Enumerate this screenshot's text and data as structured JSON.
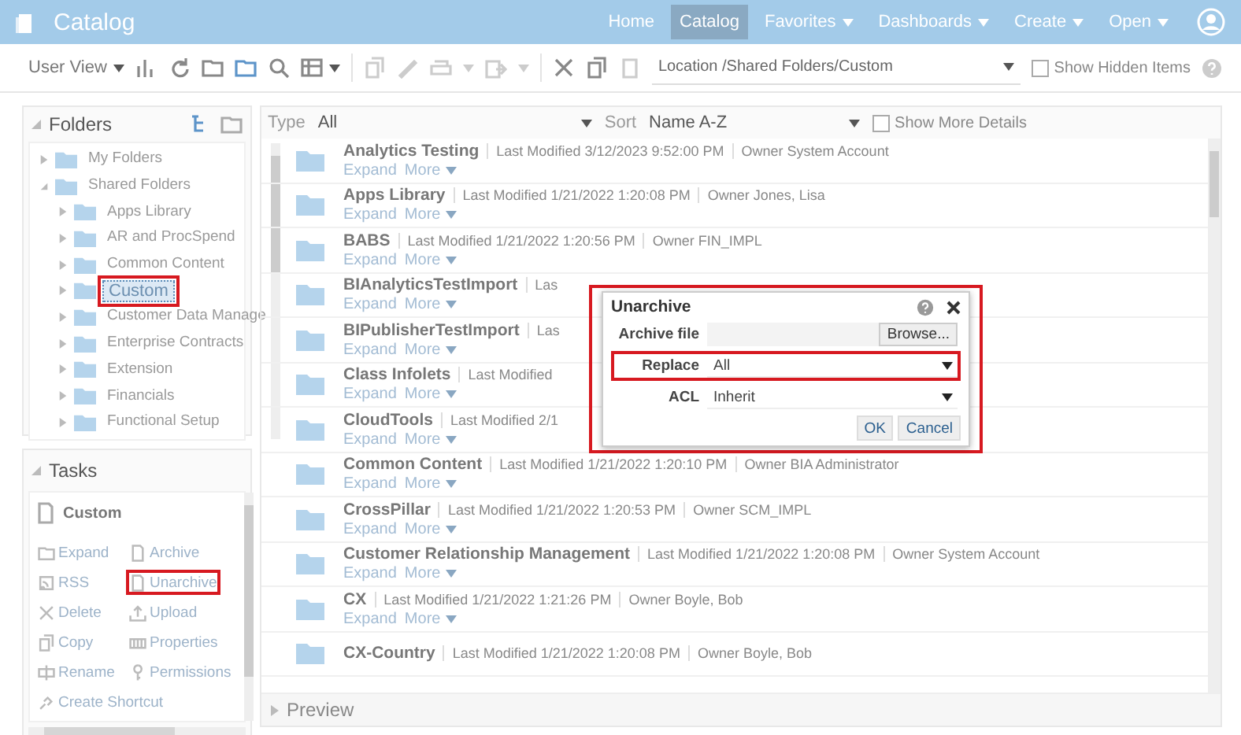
{
  "app_bar": {
    "title": "Catalog",
    "nav": [
      {
        "label": "Home",
        "selected": false,
        "dropdown": false
      },
      {
        "label": "Catalog",
        "selected": true,
        "dropdown": false
      },
      {
        "label": "Favorites",
        "selected": false,
        "dropdown": true
      },
      {
        "label": "Dashboards",
        "selected": false,
        "dropdown": true
      },
      {
        "label": "Create",
        "selected": false,
        "dropdown": true
      },
      {
        "label": "Open",
        "selected": false,
        "dropdown": true
      }
    ]
  },
  "toolbar": {
    "view": "User View",
    "location_label": "Location",
    "location": "/Shared Folders/Custom",
    "show_hidden": {
      "label": "Show Hidden Items",
      "checked": false
    }
  },
  "folders": {
    "title": "Folders",
    "tree": [
      {
        "label": "My Folders",
        "expanded": false,
        "selected": false,
        "highlighted": false
      },
      {
        "label": "Shared Folders",
        "expanded": true,
        "selected": false,
        "highlighted": false,
        "children": [
          {
            "label": "Apps Library",
            "expanded": false,
            "selected": false,
            "highlighted": false
          },
          {
            "label": "AR and ProcSpend",
            "expanded": false,
            "selected": false,
            "highlighted": false
          },
          {
            "label": "Common Content",
            "expanded": false,
            "selected": false,
            "highlighted": false
          },
          {
            "label": "Custom",
            "expanded": false,
            "selected": true,
            "highlighted": true
          },
          {
            "label": "Customer Data Manage",
            "expanded": false,
            "selected": false,
            "highlighted": false
          },
          {
            "label": "Enterprise Contracts",
            "expanded": false,
            "selected": false,
            "highlighted": false
          },
          {
            "label": "Extension",
            "expanded": false,
            "selected": false,
            "highlighted": false
          },
          {
            "label": "Financials",
            "expanded": false,
            "selected": false,
            "highlighted": false
          },
          {
            "label": "Functional Setup",
            "expanded": false,
            "selected": false,
            "highlighted": false
          }
        ]
      }
    ]
  },
  "tasks": {
    "title": "Tasks",
    "context": "Custom",
    "items": [
      {
        "label": "Expand",
        "highlighted": false
      },
      {
        "label": "Archive",
        "highlighted": false
      },
      {
        "label": "RSS",
        "highlighted": false
      },
      {
        "label": "Unarchive",
        "highlighted": true
      },
      {
        "label": "Delete",
        "highlighted": false
      },
      {
        "label": "Upload",
        "highlighted": false
      },
      {
        "label": "Copy",
        "highlighted": false
      },
      {
        "label": "Properties",
        "highlighted": false
      },
      {
        "label": "Rename",
        "highlighted": false
      },
      {
        "label": "Permissions",
        "highlighted": false
      },
      {
        "label": "Create Shortcut",
        "highlighted": false
      }
    ]
  },
  "list": {
    "type_label": "Type",
    "type_value": "All",
    "sort_label": "Sort",
    "sort_value": "Name A-Z",
    "show_details": {
      "label": "Show More Details",
      "checked": false
    },
    "rows": [
      {
        "name": "Analytics Testing",
        "meta": [
          "Last Modified 3/12/2023 9:52:00 PM",
          "Owner System Account"
        ],
        "actions": [
          "Expand",
          "More"
        ]
      },
      {
        "name": "Apps Library",
        "meta": [
          "Last Modified 1/21/2022 1:20:08 PM",
          "Owner Jones, Lisa"
        ],
        "actions": [
          "Expand",
          "More"
        ]
      },
      {
        "name": "BABS",
        "meta": [
          "Last Modified 1/21/2022 1:20:56 PM",
          "Owner FIN_IMPL"
        ],
        "actions": [
          "Expand",
          "More"
        ]
      },
      {
        "name": "BIAnalyticsTestImport",
        "meta": [
          "Las"
        ],
        "actions": [
          "Expand",
          "More"
        ]
      },
      {
        "name": "BIPublisherTestImport",
        "meta": [
          "Las"
        ],
        "actions": [
          "Expand",
          "More"
        ]
      },
      {
        "name": "Class Infolets",
        "meta": [
          "Last Modified"
        ],
        "actions": [
          "Expand",
          "More"
        ]
      },
      {
        "name": "CloudTools",
        "meta": [
          "Last Modified 2/1"
        ],
        "actions": [
          "Expand",
          "More"
        ]
      },
      {
        "name": "Common Content",
        "meta": [
          "Last Modified 1/21/2022 1:20:10 PM",
          "Owner BIA Administrator"
        ],
        "actions": [
          "Expand",
          "More"
        ]
      },
      {
        "name": "CrossPillar",
        "meta": [
          "Last Modified 1/21/2022 1:20:53 PM",
          "Owner SCM_IMPL"
        ],
        "actions": [
          "Expand",
          "More"
        ]
      },
      {
        "name": "Customer Relationship Management",
        "meta": [
          "Last Modified 1/21/2022 1:20:08 PM",
          "Owner System Account"
        ],
        "actions": [
          "Expand",
          "More"
        ]
      },
      {
        "name": "CX",
        "meta": [
          "Last Modified 1/21/2022 1:21:26 PM",
          "Owner Boyle, Bob"
        ],
        "actions": [
          "Expand",
          "More"
        ]
      },
      {
        "name": "CX-Country",
        "meta": [
          "Last Modified 1/21/2022 1:20:08 PM",
          "Owner Boyle, Bob"
        ],
        "actions": []
      }
    ],
    "preview": "Preview"
  },
  "dialog": {
    "title": "Unarchive",
    "highlighted": true,
    "fields": [
      {
        "kind": "file",
        "label": "Archive file",
        "button": "Browse...",
        "highlighted": false
      },
      {
        "kind": "select",
        "label": "Replace",
        "value": "All",
        "highlighted": true
      },
      {
        "kind": "select",
        "label": "ACL",
        "value": "Inherit",
        "highlighted": false
      }
    ],
    "buttons": [
      "OK",
      "Cancel"
    ]
  }
}
